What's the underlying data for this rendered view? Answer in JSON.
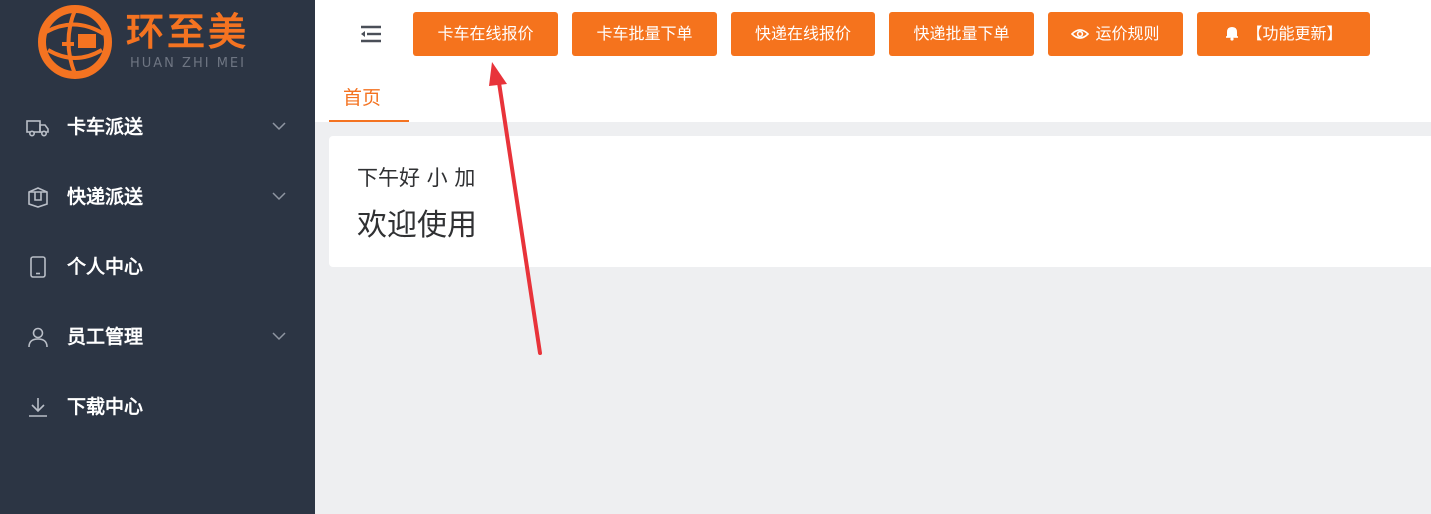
{
  "logo": {
    "name": "环至美",
    "subtitle": "HUAN ZHI MEI"
  },
  "sidebar": {
    "items": [
      {
        "label": "卡车派送",
        "icon": "truck-icon",
        "expandable": true
      },
      {
        "label": "快递派送",
        "icon": "package-icon",
        "expandable": true
      },
      {
        "label": "个人中心",
        "icon": "phone-icon",
        "expandable": false
      },
      {
        "label": "员工管理",
        "icon": "user-icon",
        "expandable": true
      },
      {
        "label": "下载中心",
        "icon": "download-icon",
        "expandable": false
      }
    ]
  },
  "toolbar": {
    "buttons": [
      {
        "label": "卡车在线报价"
      },
      {
        "label": "卡车批量下单"
      },
      {
        "label": "快递在线报价"
      },
      {
        "label": "快递批量下单"
      },
      {
        "label": "运价规则",
        "icon": "eye-icon"
      },
      {
        "label": "【功能更新】",
        "icon": "bell-icon"
      }
    ]
  },
  "tabs": [
    {
      "label": "首页",
      "active": true
    }
  ],
  "welcome": {
    "greeting": "下午好 小 加",
    "message": "欢迎使用"
  },
  "colors": {
    "accent": "#f47321",
    "sidebar_bg": "#2c3544",
    "annotation": "#e8333a"
  }
}
